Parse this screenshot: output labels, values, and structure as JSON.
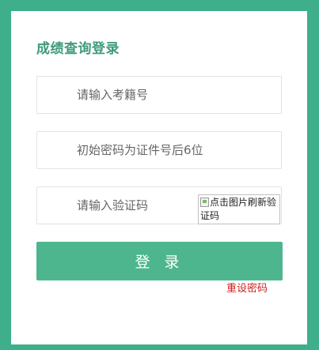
{
  "login": {
    "title": "成绩查询登录",
    "exam_number_placeholder": "请输入考籍号",
    "password_placeholder": "初始密码为证件号后6位",
    "captcha_placeholder": "请输入验证码",
    "captcha_image_alt": "点击图片刷新验证码",
    "submit_label": "登 录",
    "reset_password_label": "重设密码"
  },
  "colors": {
    "frame": "#3fae8b",
    "title": "#3e9b78",
    "button": "#4db68f",
    "reset_link": "#cc1f1f"
  }
}
